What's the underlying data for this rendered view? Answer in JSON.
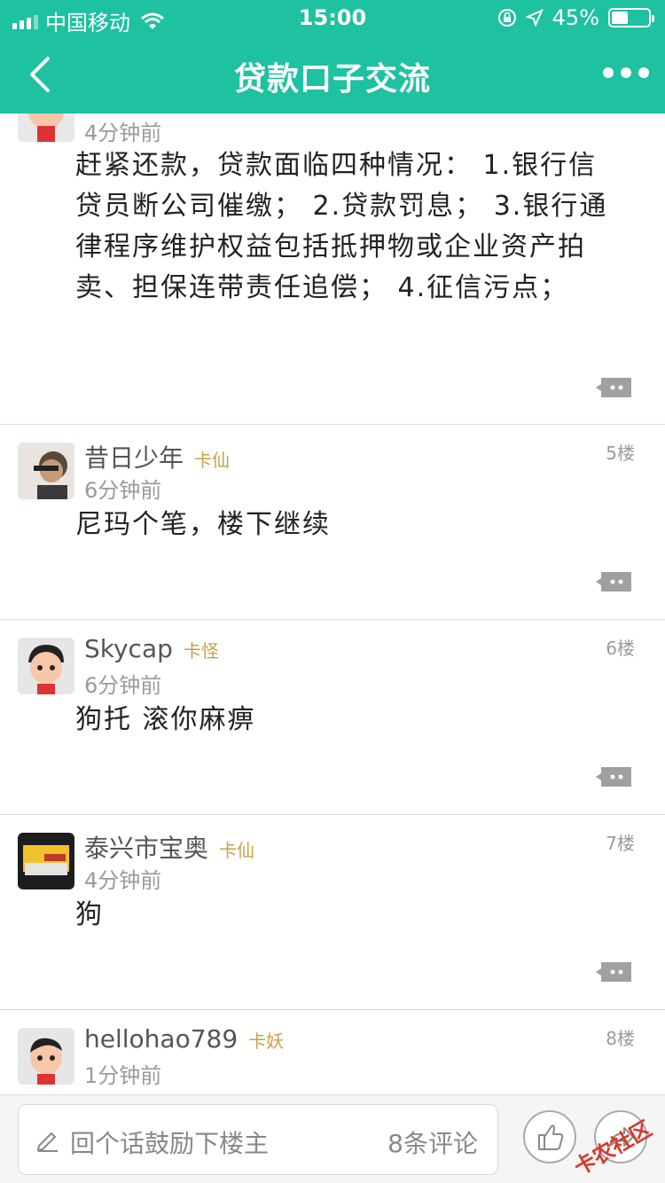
{
  "status_bar": {
    "carrier": "中国移动",
    "time": "15:00",
    "battery": "45%",
    "battery_level": 0.45
  },
  "nav": {
    "title": "贷款口子交流",
    "back_icon": "chevron-left-icon",
    "more_icon": "more-dots-icon"
  },
  "posts": [
    {
      "time_ago": "4分钟前",
      "content": "赶紧还款，贷款面临四种情况： 1.银行信贷员断公司催缴； 2.贷款罚息； 3.银行通律程序维护权益包括抵押物或企业资产拍卖、担保连带责任追偿； 4.征信污点；"
    },
    {
      "username": "昔日少年",
      "badge": "卡仙",
      "time_ago": "6分钟前",
      "floor": "5楼",
      "content": "尼玛个笔，楼下继续"
    },
    {
      "username": "Skycap",
      "badge": "卡怪",
      "time_ago": "6分钟前",
      "floor": "6楼",
      "content": "狗托 滚你麻痹"
    },
    {
      "username": "泰兴市宝奥",
      "badge": "卡仙",
      "time_ago": "4分钟前",
      "floor": "7楼",
      "content": "狗"
    },
    {
      "username": "hellohao789",
      "badge": "卡妖",
      "time_ago": "1分钟前",
      "floor": "8楼"
    }
  ],
  "bottom_bar": {
    "placeholder": "回个话鼓励下楼主",
    "comment_count": "8条评论",
    "watermark": "卡农社区"
  },
  "colors": {
    "accent": "#1ec1a0",
    "badge": "#c9a04a"
  }
}
